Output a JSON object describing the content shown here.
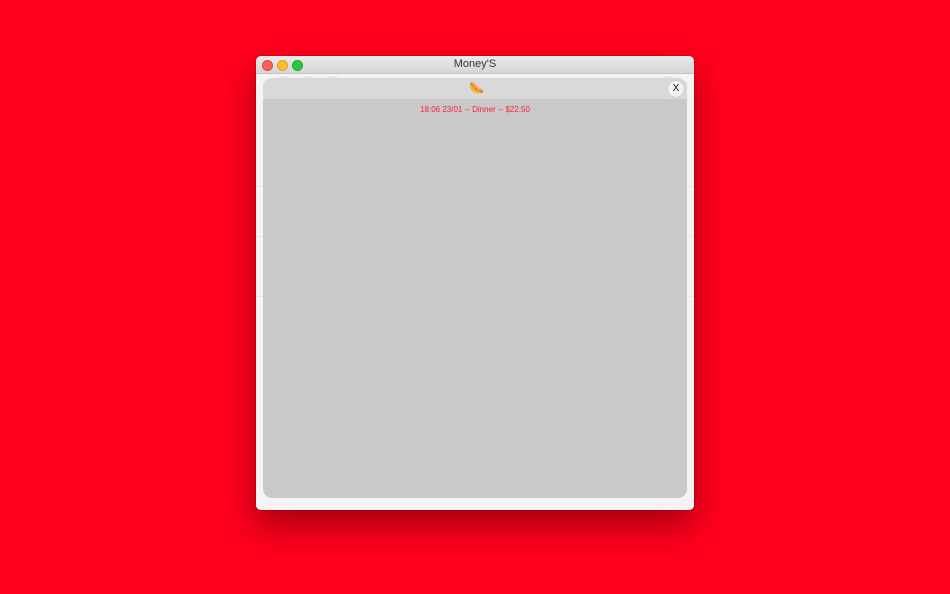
{
  "window": {
    "title": "Money'S"
  },
  "overlay": {
    "icon": "hot-dog-icon",
    "icon_glyph": "🌭",
    "close_label": "X",
    "entry": "18:06 23/01 -- Dinner -- $22.50",
    "entry_color": "#ff1e2e"
  },
  "colors": {
    "desktop": "#ff001c",
    "overlay_background": "#c9c9c9",
    "overlay_header": "#d9d9d9"
  }
}
